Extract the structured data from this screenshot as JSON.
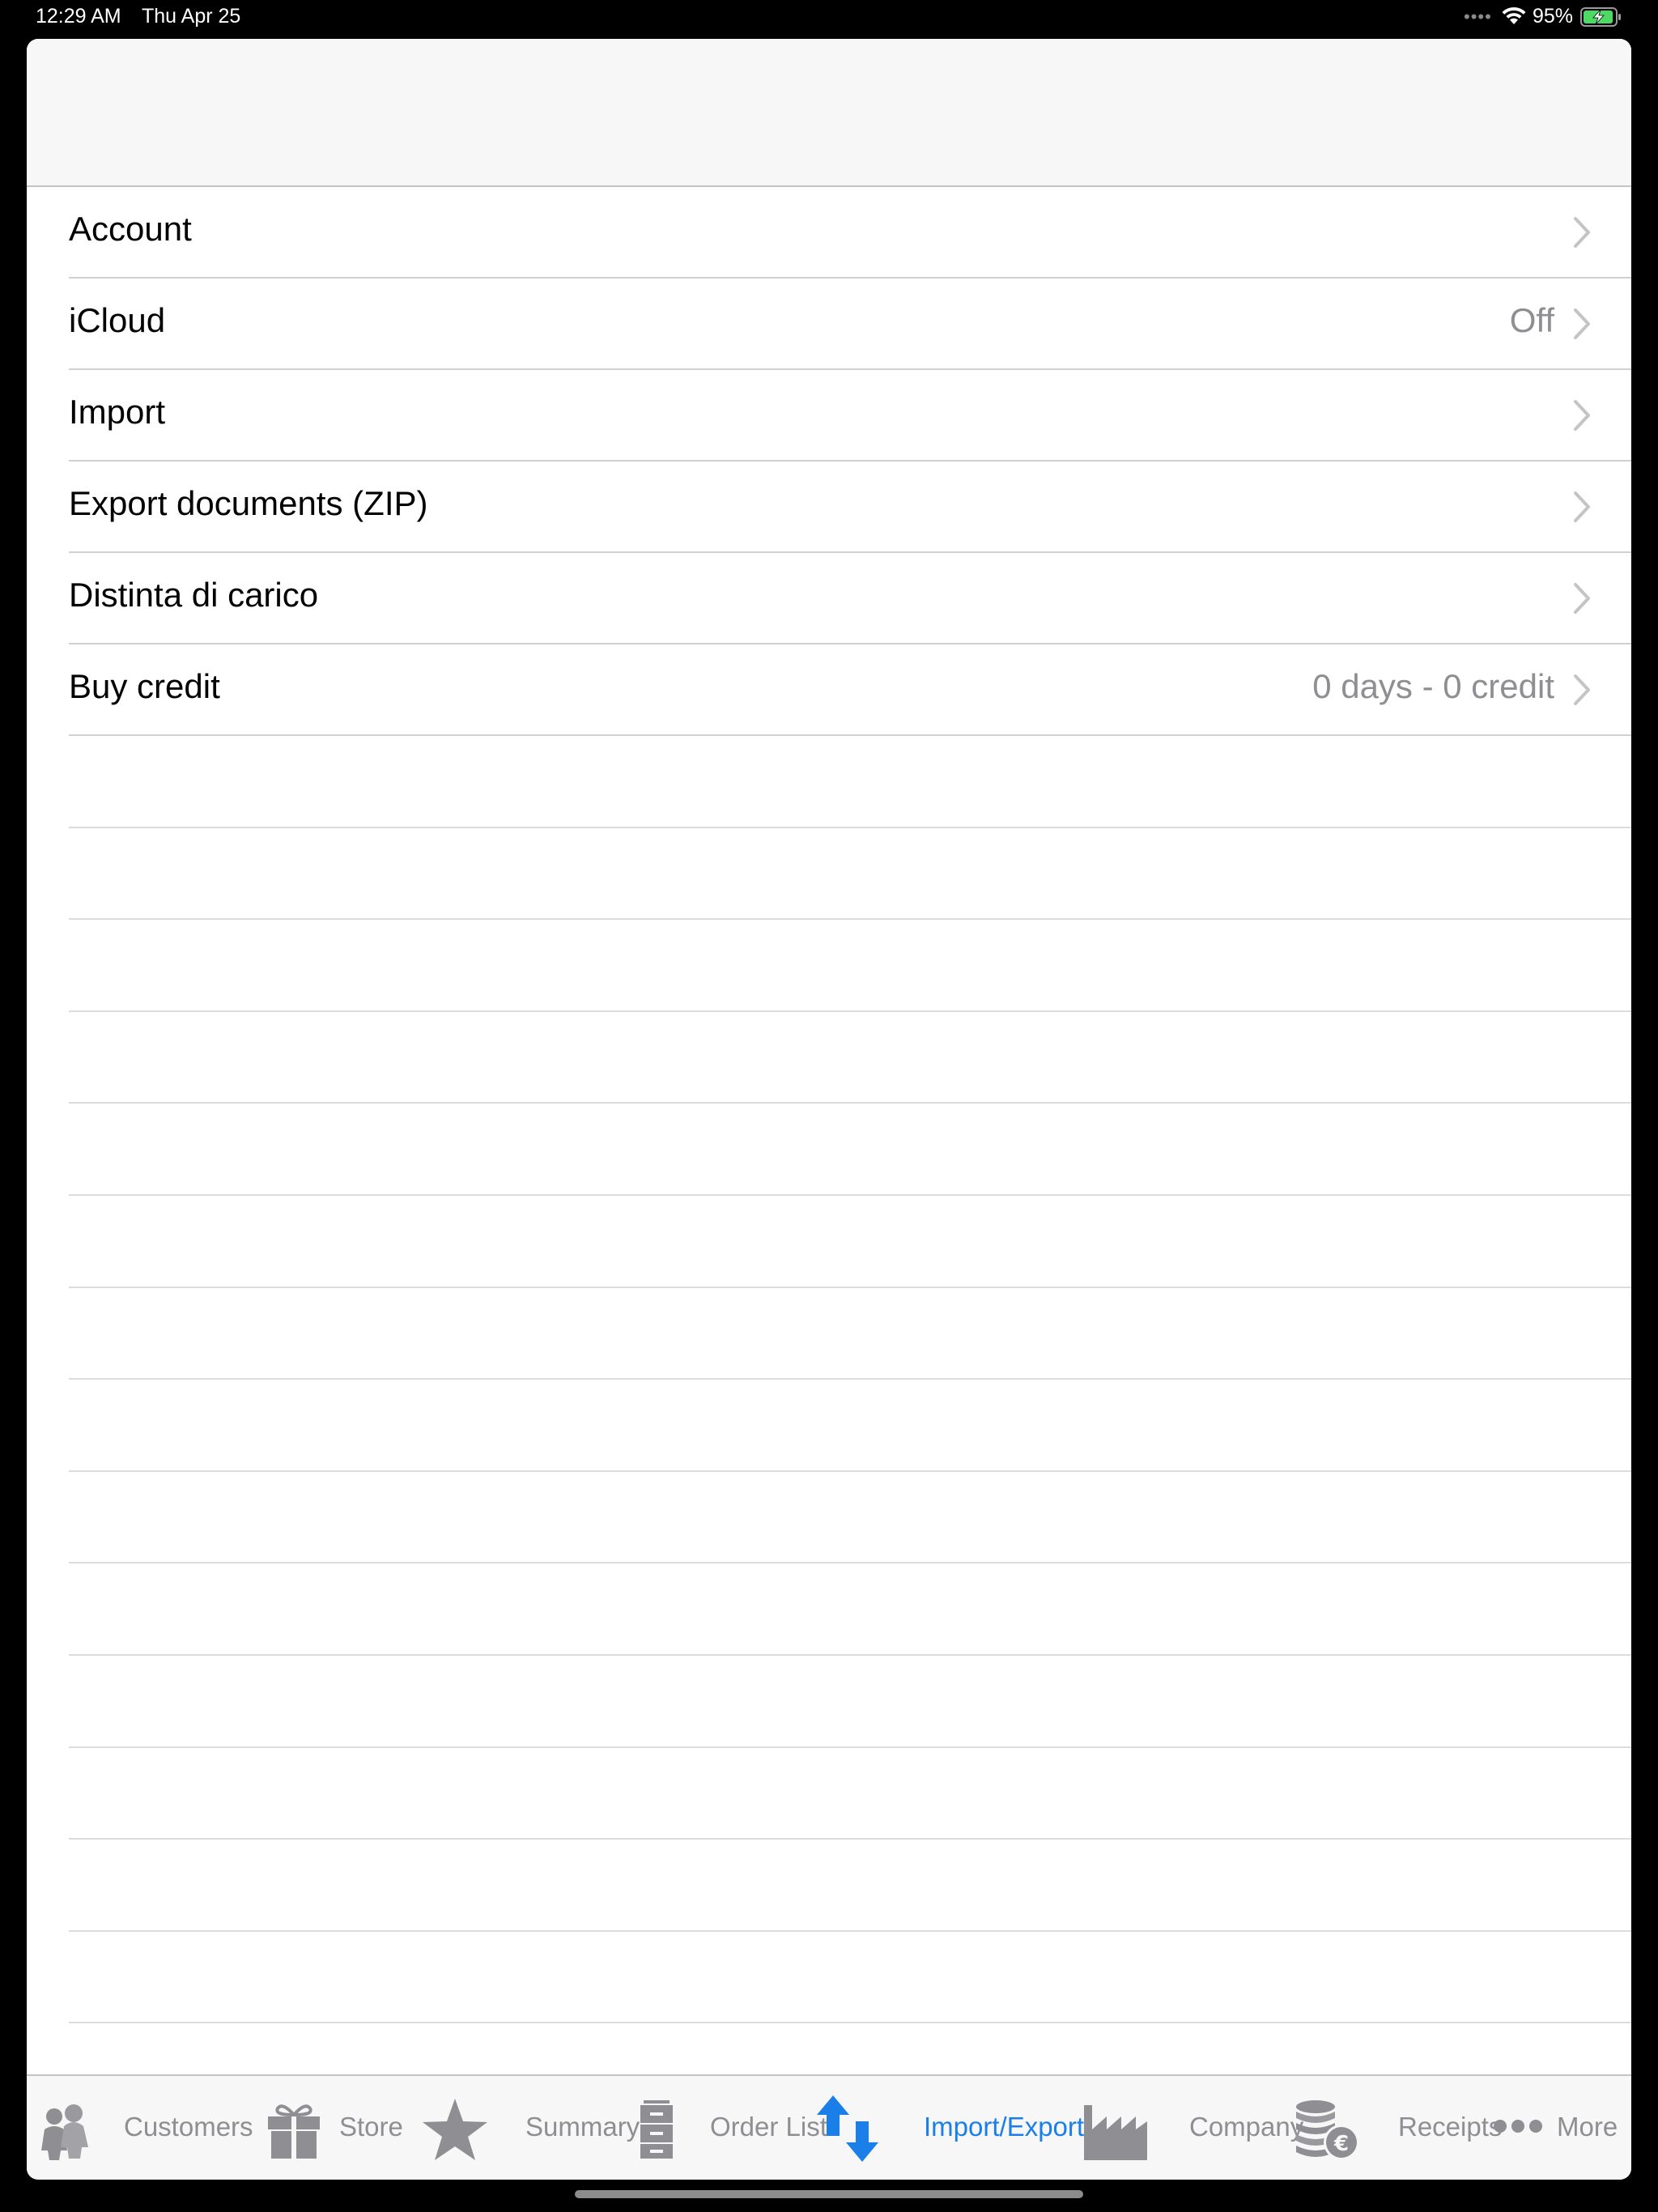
{
  "status_bar": {
    "time": "12:29 AM",
    "date": "Thu Apr 25",
    "cellular_dots": "••••",
    "wifi_icon": "wifi-icon",
    "battery_percent": "95%",
    "battery_icon": "battery-charging-icon",
    "battery_level": 0.95,
    "battery_color": "#4cd964"
  },
  "settings_list": {
    "rows": [
      {
        "label": "Account",
        "detail": ""
      },
      {
        "label": "iCloud",
        "detail": "Off"
      },
      {
        "label": "Import",
        "detail": ""
      },
      {
        "label": "Export documents (ZIP)",
        "detail": ""
      },
      {
        "label": "Distinta di carico",
        "detail": ""
      },
      {
        "label": "Buy credit",
        "detail": "0 days - 0 credit"
      }
    ],
    "chevron_icon": "chevron-right-icon"
  },
  "tab_bar": {
    "tabs": [
      {
        "label": "Customers",
        "icon": "people-icon",
        "active": false
      },
      {
        "label": "Store",
        "icon": "gift-icon",
        "active": false
      },
      {
        "label": "Summary",
        "icon": "star-icon",
        "active": false
      },
      {
        "label": "Order List",
        "icon": "file-cabinet-icon",
        "active": false
      },
      {
        "label": "Import/Export",
        "icon": "up-down-arrows-icon",
        "active": true
      },
      {
        "label": "Company",
        "icon": "factory-icon",
        "active": false
      },
      {
        "label": "Receipts",
        "icon": "coins-euro-icon",
        "active": false
      },
      {
        "label": "More",
        "icon": "more-dots-icon",
        "active": false
      }
    ],
    "active_color": "#1a7fe8",
    "inactive_color": "#8e8e93"
  }
}
